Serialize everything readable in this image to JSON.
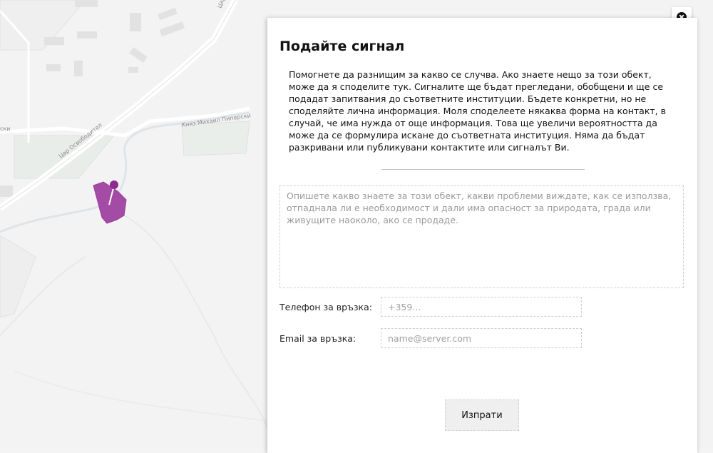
{
  "map": {
    "road_labels": [
      "Цар Освободител",
      "Княз Михаил Пиперски",
      "ски",
      "Цар"
    ]
  },
  "dialog": {
    "title": "Подайте сигнал",
    "intro": "Помогнете да разнищим за какво се случва. Ако знаете нещо за този обект, може да я споделите тук. Сигналите ще бъдат прегледани, обобщени и ще се подадат запитвания до съответните институции. Бъдете конкретни, но не споделяйте лична информация. Моля споделеете някаква форма на контакт, в случай, че има нужда от още информация. Това ще увеличи вероятността да може да се формулира искане до съответната институция. Няма да бъдат разкривани или публикувани контактите или сигналът Ви.",
    "description_placeholder": "Опишете какво знаете за този обект, какви проблеми виждате, как се използва, отпаднала ли е необходимост и дали има опасност за природата, града или живущите наоколо, ако се продаде.",
    "phone_label": "Телефон за връзка:",
    "phone_placeholder": "+359...",
    "email_label": "Email за връзка:",
    "email_placeholder": "name@server.com",
    "submit_label": "Изпрати"
  },
  "colors": {
    "marker": "#9b3a9c",
    "marker_pin": "#8e2b8f"
  }
}
